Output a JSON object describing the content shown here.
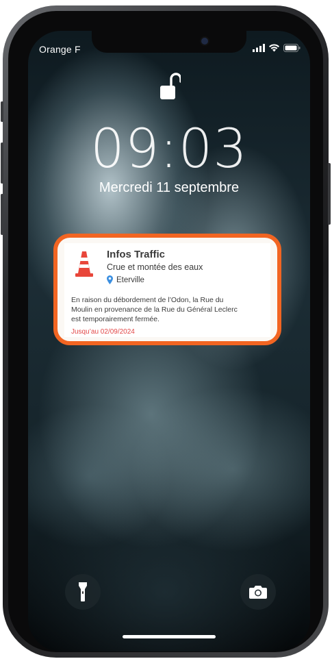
{
  "status_bar": {
    "carrier": "Orange F",
    "signal_icon": "cellular-signal-icon",
    "wifi_icon": "wifi-icon",
    "battery_icon": "battery-icon"
  },
  "lock_screen": {
    "lock_icon": "unlocked-padlock-icon",
    "time": "09:03",
    "date": "Mercredi 11 septembre"
  },
  "notification": {
    "icon": "traffic-cone-icon",
    "title": "Infos Traffic",
    "subtitle": "Crue et montée des eaux",
    "location_icon": "map-pin-icon",
    "location": "Eterville",
    "body": "En raison du débordement de l’Odon, la Rue du Moulin en provenance de la Rue du Général Leclerc est temporairement fermée.",
    "until": "Jusqu’au 02/09/2024",
    "highlight_color": "#f26522",
    "until_color": "#e24848",
    "pin_color": "#3b8fe0"
  },
  "quick_actions": {
    "flashlight_icon": "flashlight-icon",
    "camera_icon": "camera-icon"
  }
}
